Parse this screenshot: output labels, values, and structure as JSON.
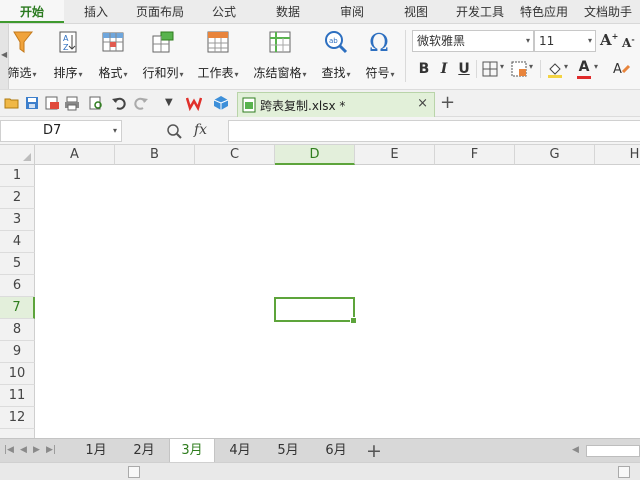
{
  "menu": {
    "tabs": [
      "开始",
      "插入",
      "页面布局",
      "公式",
      "数据",
      "审阅",
      "视图",
      "开发工具",
      "特色应用",
      "文档助手"
    ],
    "active": "开始"
  },
  "ribbon": {
    "filter_label": "筛选",
    "sort_label": "排序",
    "format_label": "格式",
    "rowcol_label": "行和列",
    "sheet_label": "工作表",
    "freeze_label": "冻结窗格",
    "find_label": "查找",
    "symbol_label": "符号",
    "font_name": "微软雅黑",
    "font_size": "11",
    "grow_font": "A",
    "shrink_font": "A",
    "bold": "B",
    "italic": "I",
    "underline": "U",
    "font_color_letter": "A"
  },
  "quickbar": {
    "document_name": "跨表复制.xlsx *",
    "close": "×",
    "new_tab": "+"
  },
  "formula_bar": {
    "cell_ref": "D7",
    "fx": "fx",
    "formula_value": ""
  },
  "grid": {
    "columns": [
      "A",
      "B",
      "C",
      "D",
      "E",
      "F",
      "G",
      "H"
    ],
    "rows": [
      "1",
      "2",
      "3",
      "4",
      "5",
      "6",
      "7",
      "8",
      "9",
      "10",
      "11",
      "12"
    ],
    "selected_column": "D",
    "selected_row": "7"
  },
  "sheets": {
    "tabs": [
      "1月",
      "2月",
      "3月",
      "4月",
      "5月",
      "6月"
    ],
    "active": "3月",
    "add": "+"
  },
  "colors": {
    "accent": "#5da43b",
    "accent_dark": "#2f7d1e",
    "tab_active_bg": "#e2f0d9"
  }
}
